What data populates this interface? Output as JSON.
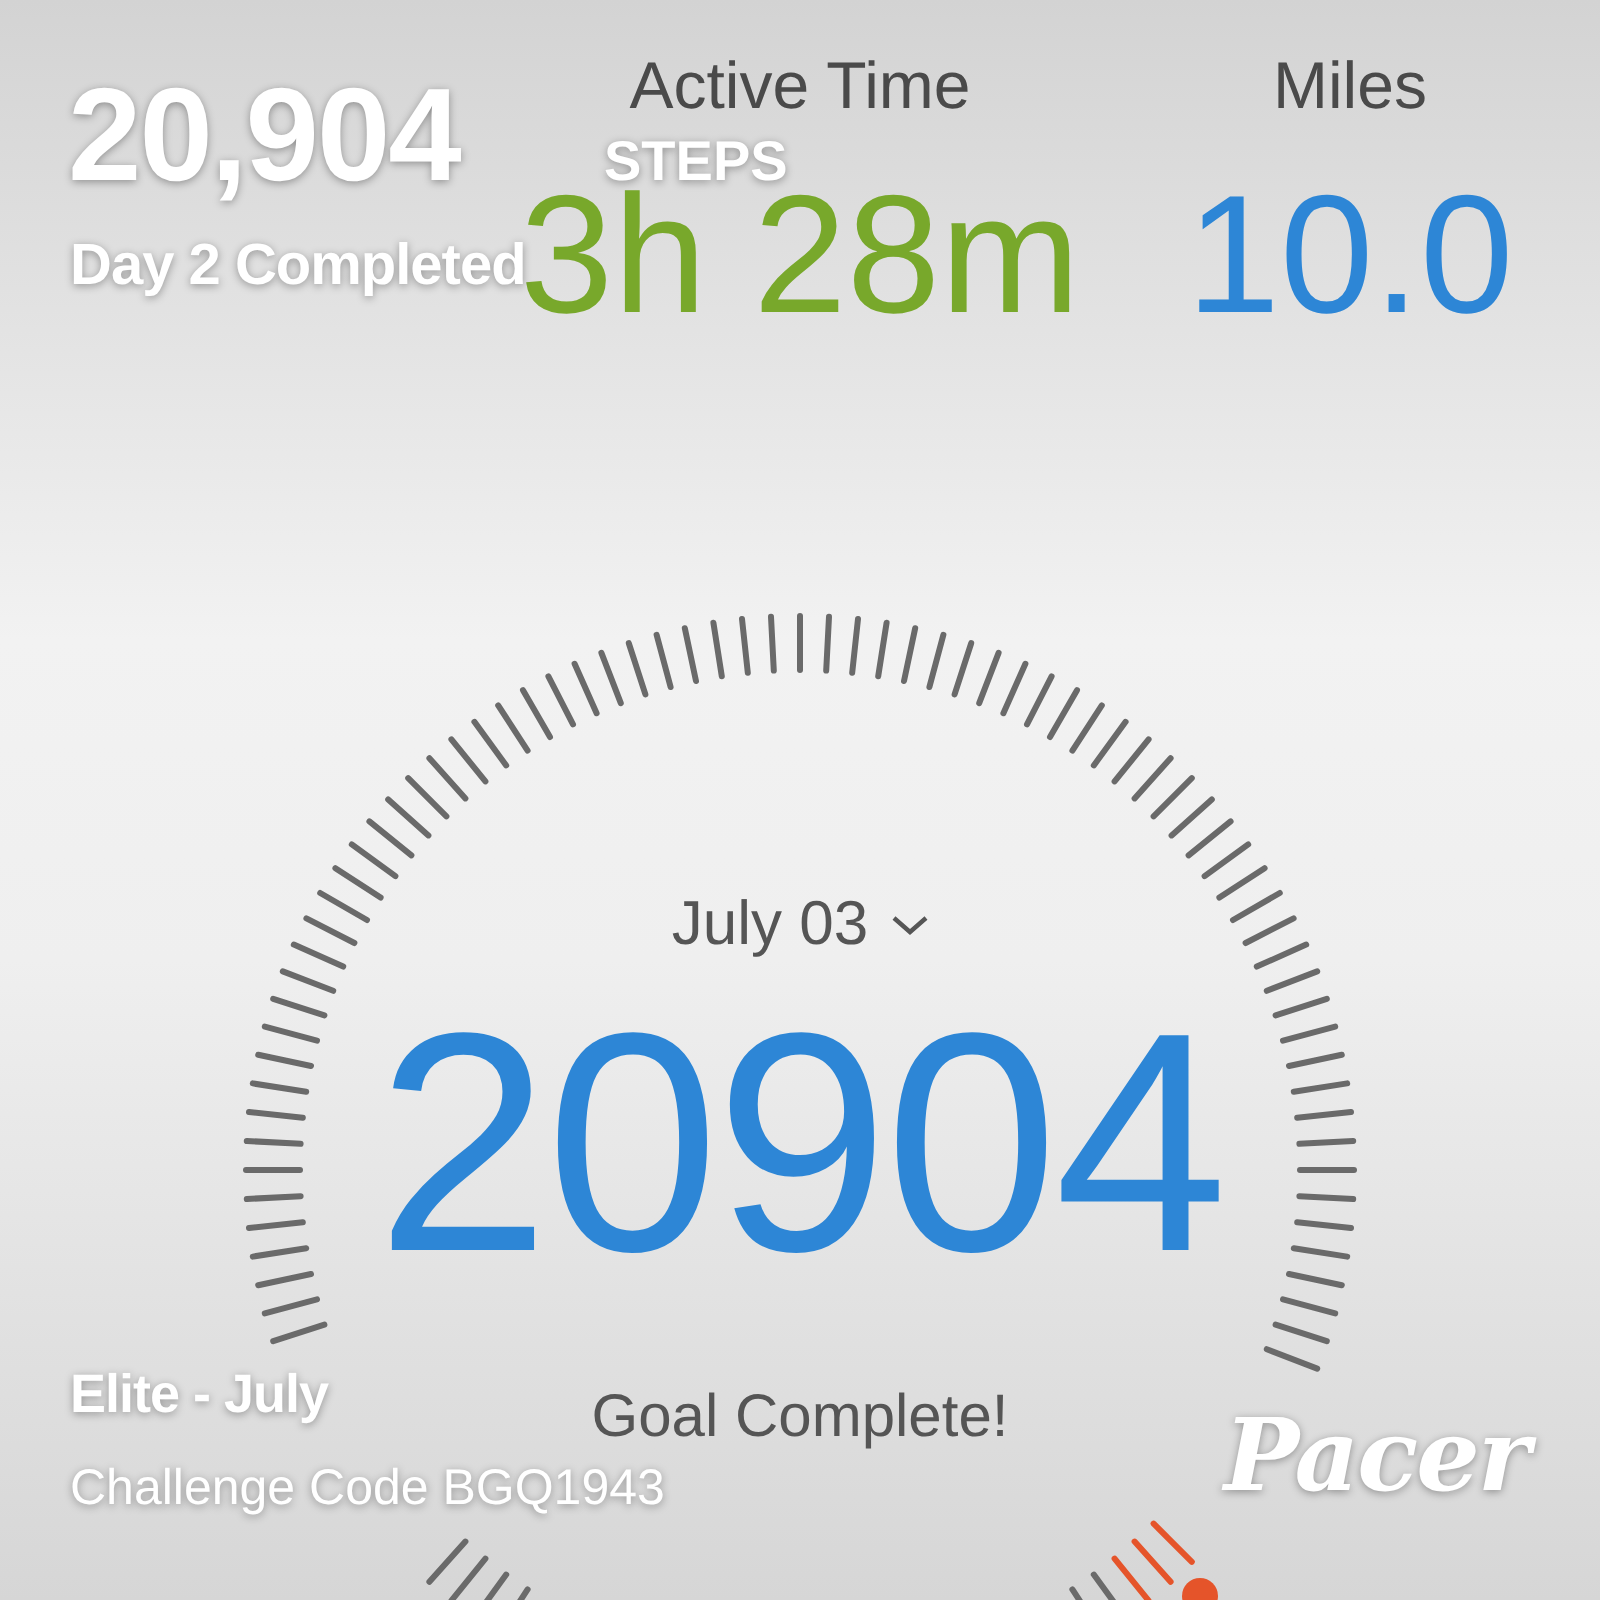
{
  "stats": [
    {
      "label": "Active Time",
      "value": "3h 28m",
      "color": "#78a82b"
    },
    {
      "label": "Miles",
      "value": "10.0",
      "color": "#2d86d6"
    }
  ],
  "date_picker": {
    "label": "July 03"
  },
  "step_count": "20904",
  "goal_status": "Goal Complete!",
  "overlay": {
    "steps": "20,904",
    "steps_unit": "STEPS",
    "day_status": "Day 2 Completed",
    "challenge_name": "Elite - July",
    "challenge_code": "Challenge Code BGQ1943",
    "brand": "Pacer"
  }
}
